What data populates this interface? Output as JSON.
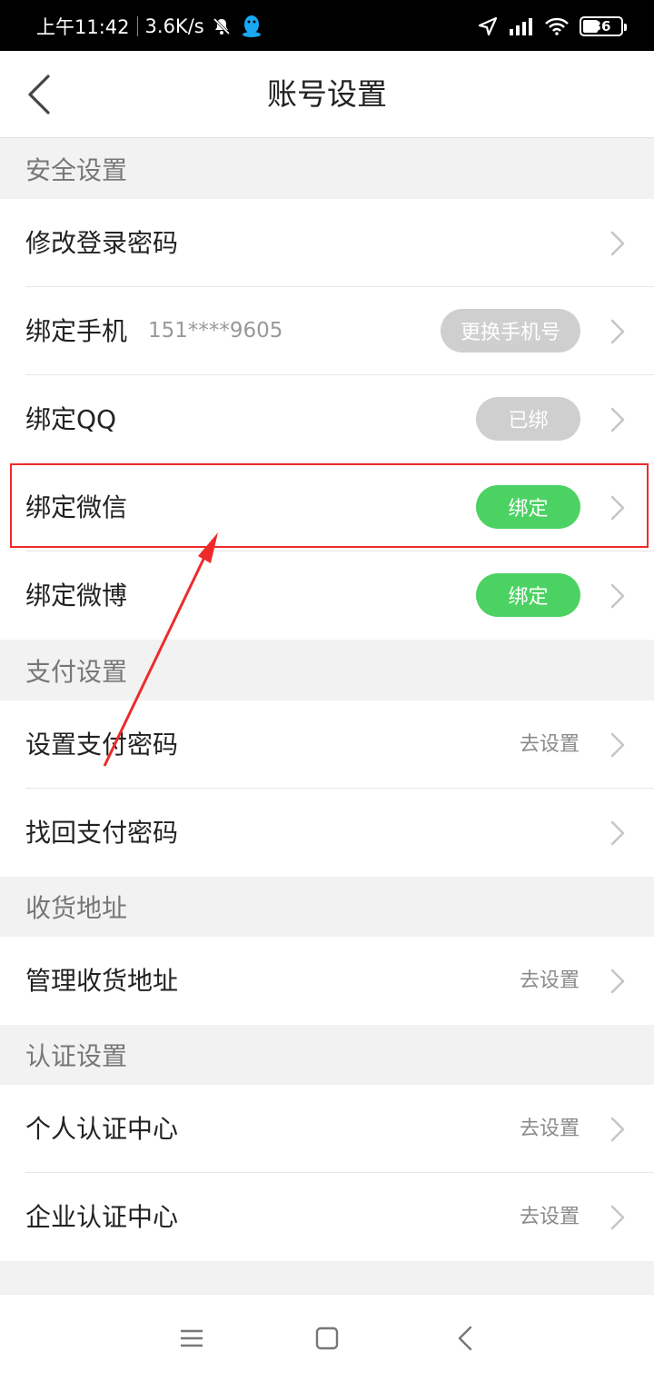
{
  "status_bar": {
    "time": "上午11:42",
    "speed": "3.6K/s",
    "battery": "36"
  },
  "nav": {
    "title": "账号设置"
  },
  "sections": {
    "security": {
      "title": "安全设置",
      "change_password": {
        "label": "修改登录密码"
      },
      "bind_phone": {
        "label": "绑定手机",
        "value": "151****9605",
        "button": "更换手机号"
      },
      "bind_qq": {
        "label": "绑定QQ",
        "status": "已绑"
      },
      "bind_wechat": {
        "label": "绑定微信",
        "button": "绑定"
      },
      "bind_weibo": {
        "label": "绑定微博",
        "button": "绑定"
      }
    },
    "payment": {
      "title": "支付设置",
      "set_pay_password": {
        "label": "设置支付密码",
        "hint": "去设置"
      },
      "recover_pay_password": {
        "label": "找回支付密码"
      }
    },
    "address": {
      "title": "收货地址",
      "manage_address": {
        "label": "管理收货地址",
        "hint": "去设置"
      }
    },
    "certification": {
      "title": "认证设置",
      "personal": {
        "label": "个人认证中心",
        "hint": "去设置"
      },
      "enterprise": {
        "label": "企业认证中心",
        "hint": "去设置"
      }
    }
  },
  "colors": {
    "accent_green": "#4cd263",
    "pill_gray": "#cfcfcf",
    "annotation_red": "#ee2b2b"
  },
  "icons": {
    "back": "chevron-left-icon",
    "row_arrow": "chevron-right-icon",
    "menu": "menu-icon",
    "home": "home-square-icon",
    "sys_back": "back-triangle-icon"
  }
}
